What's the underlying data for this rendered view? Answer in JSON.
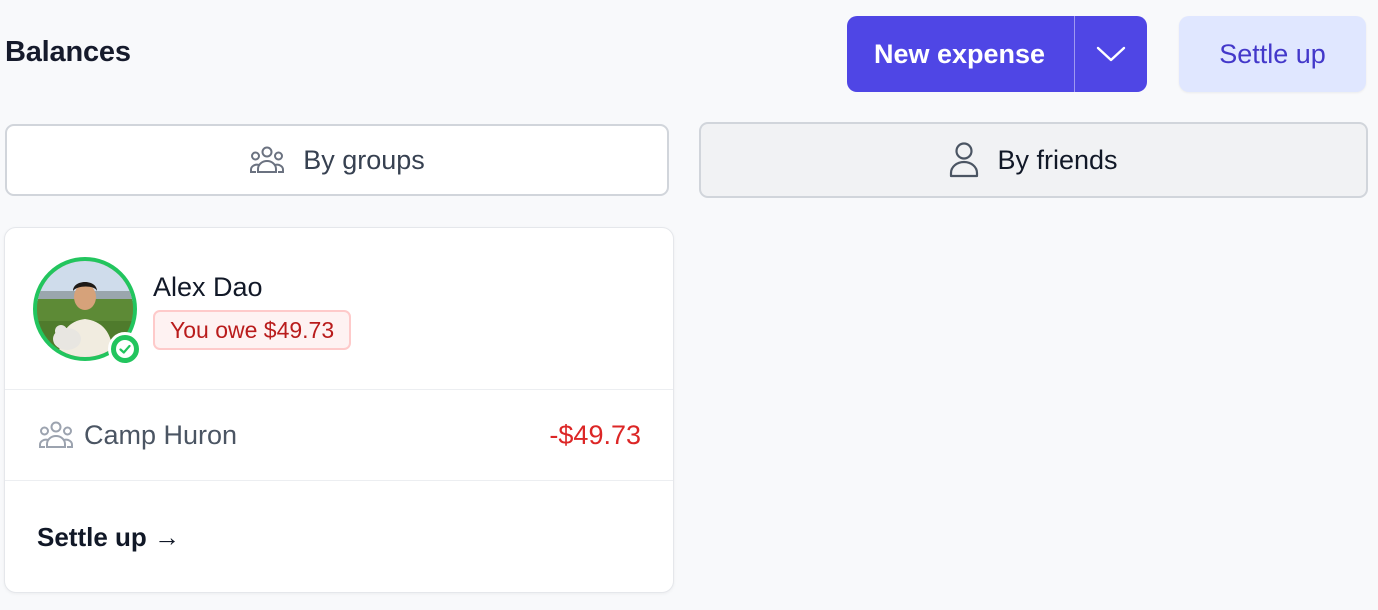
{
  "header": {
    "title": "Balances",
    "new_expense_label": "New expense",
    "settle_up_label": "Settle up"
  },
  "view_toggle": {
    "groups_label": "By groups",
    "friends_label": "By friends",
    "active": "By friends"
  },
  "balance_card": {
    "friend_name": "Alex Dao",
    "summary": "You owe $49.73",
    "verified": true,
    "groups": [
      {
        "name": "Camp Huron",
        "amount": "-$49.73"
      }
    ],
    "settle_up_link": "Settle up →"
  },
  "colors": {
    "primary": "#4f46e5",
    "primary_light": "#e0e7ff",
    "negative": "#dc2626",
    "success": "#22c55e"
  },
  "icons": {
    "new_expense_dropdown": "chevron-down-icon",
    "groups_toggle": "users-group-icon",
    "friends_toggle": "user-icon",
    "verified": "check-circle-icon",
    "group_row": "users-group-icon"
  }
}
